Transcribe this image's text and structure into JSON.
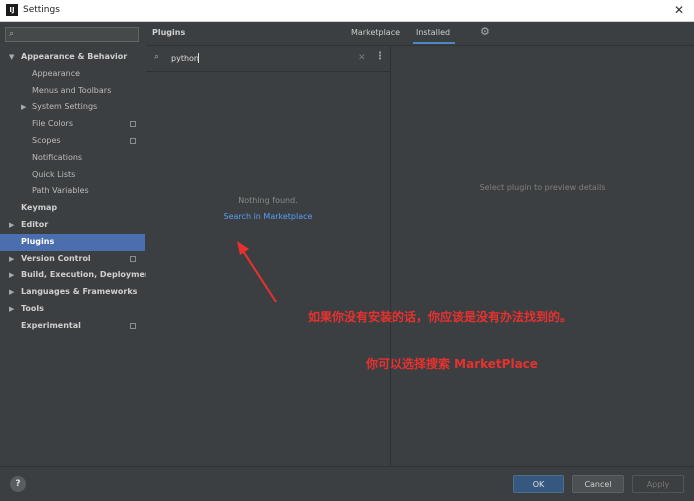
{
  "window": {
    "title": "Settings",
    "app_icon_text": "IJ",
    "close_glyph": "✕"
  },
  "sidebar": {
    "search_placeholder": "",
    "items": [
      {
        "label": "Appearance & Behavior",
        "bold": true,
        "arrow": "down",
        "indent": 0
      },
      {
        "label": "Appearance",
        "indent": 1
      },
      {
        "label": "Menus and Toolbars",
        "indent": 1
      },
      {
        "label": "System Settings",
        "indent": 1,
        "arrow": "right"
      },
      {
        "label": "File Colors",
        "indent": 1,
        "copy_icon": true
      },
      {
        "label": "Scopes",
        "indent": 1,
        "copy_icon": true
      },
      {
        "label": "Notifications",
        "indent": 1
      },
      {
        "label": "Quick Lists",
        "indent": 1
      },
      {
        "label": "Path Variables",
        "indent": 1
      },
      {
        "label": "Keymap",
        "bold": true,
        "indent": 0
      },
      {
        "label": "Editor",
        "bold": true,
        "arrow": "right",
        "indent": 0
      },
      {
        "label": "Plugins",
        "bold": true,
        "indent": 0,
        "selected": true
      },
      {
        "label": "Version Control",
        "bold": true,
        "arrow": "right",
        "indent": 0,
        "copy_icon": true
      },
      {
        "label": "Build, Execution, Deployment",
        "bold": true,
        "arrow": "right",
        "indent": 0
      },
      {
        "label": "Languages & Frameworks",
        "bold": true,
        "arrow": "right",
        "indent": 0
      },
      {
        "label": "Tools",
        "bold": true,
        "arrow": "right",
        "indent": 0
      },
      {
        "label": "Experimental",
        "bold": true,
        "indent": 0,
        "copy_icon": true
      }
    ]
  },
  "header": {
    "title": "Plugins",
    "tabs": [
      {
        "label": "Marketplace",
        "active": false
      },
      {
        "label": "Installed",
        "active": true
      }
    ]
  },
  "plugins": {
    "search_value": "python",
    "empty_text": "Nothing found.",
    "marketplace_link": "Search in Marketplace",
    "preview_text": "Select plugin to preview details"
  },
  "annotations": {
    "line1": "如果你没有安装的话，你应该是没有办法找到的。",
    "line2": "你可以选择搜索 MarketPlace",
    "color": "#e8312f"
  },
  "footer": {
    "help": "?",
    "ok": "OK",
    "cancel": "Cancel",
    "apply": "Apply"
  },
  "colors": {
    "selection": "#4b6eaf",
    "link": "#589df6",
    "background": "#3c3f41"
  },
  "icons": [
    "search-icon",
    "gear-icon",
    "more-vert-icon",
    "clear-icon",
    "copy-icon",
    "help-icon",
    "close-icon"
  ]
}
